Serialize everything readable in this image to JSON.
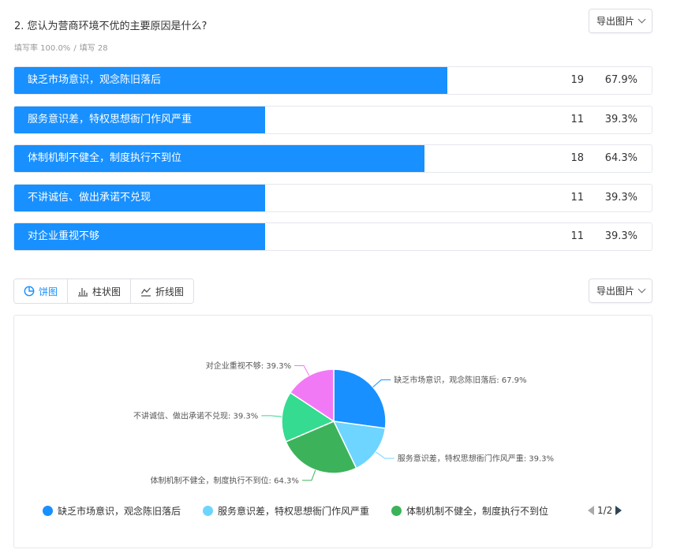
{
  "question": {
    "title": "2. 您认为营商环境不优的主要原因是什么?",
    "fill_rate": "填写率 100.0%",
    "separator": "/",
    "fill_count": "填写 28"
  },
  "export_label": "导出图片",
  "results": [
    {
      "label": "缺乏市场意识，观念陈旧落后",
      "count": "19",
      "percent": "67.9%",
      "ratio": 0.679
    },
    {
      "label": "服务意识差，特权思想衙门作风严重",
      "count": "11",
      "percent": "39.3%",
      "ratio": 0.393
    },
    {
      "label": "体制机制不健全，制度执行不到位",
      "count": "18",
      "percent": "64.3%",
      "ratio": 0.643
    },
    {
      "label": "不讲诚信、做出承诺不兑现",
      "count": "11",
      "percent": "39.3%",
      "ratio": 0.393
    },
    {
      "label": "对企业重视不够",
      "count": "11",
      "percent": "39.3%",
      "ratio": 0.393
    }
  ],
  "tabs": [
    {
      "label": "饼图",
      "icon": "pie-icon",
      "active": true
    },
    {
      "label": "柱状图",
      "icon": "bar-chart-icon",
      "active": false
    },
    {
      "label": "折线图",
      "icon": "line-chart-icon",
      "active": false
    }
  ],
  "colors": {
    "accent": "#1890ff",
    "border": "#e4e7ed"
  },
  "chart_data": {
    "type": "pie",
    "slices": [
      {
        "name": "缺乏市场意识，观念陈旧落后",
        "value": 19,
        "label": "缺乏市场意识，观念陈旧落后: 67.9%",
        "color": "#1890ff"
      },
      {
        "name": "服务意识差，特权思想衙门作风严重",
        "value": 11,
        "label": "服务意识差，特权思想衙门作风严重: 39.3%",
        "color": "#6dd5ff"
      },
      {
        "name": "体制机制不健全，制度执行不到位",
        "value": 18,
        "label": "体制机制不健全，制度执行不到位: 64.3%",
        "color": "#3cb35a"
      },
      {
        "name": "不讲诚信、做出承诺不兑现",
        "value": 11,
        "label": "不讲诚信、做出承诺不兑现: 39.3%",
        "color": "#35db90"
      },
      {
        "name": "对企业重视不够",
        "value": 11,
        "label": "对企业重视不够: 39.3%",
        "color": "#f279f5"
      }
    ],
    "legend": {
      "position": "bottom",
      "visible_items": [
        "缺乏市场意识，观念陈旧落后",
        "服务意识差，特权思想衙门作风严重",
        "体制机制不健全，制度执行不到位"
      ],
      "page": "1/2"
    }
  }
}
